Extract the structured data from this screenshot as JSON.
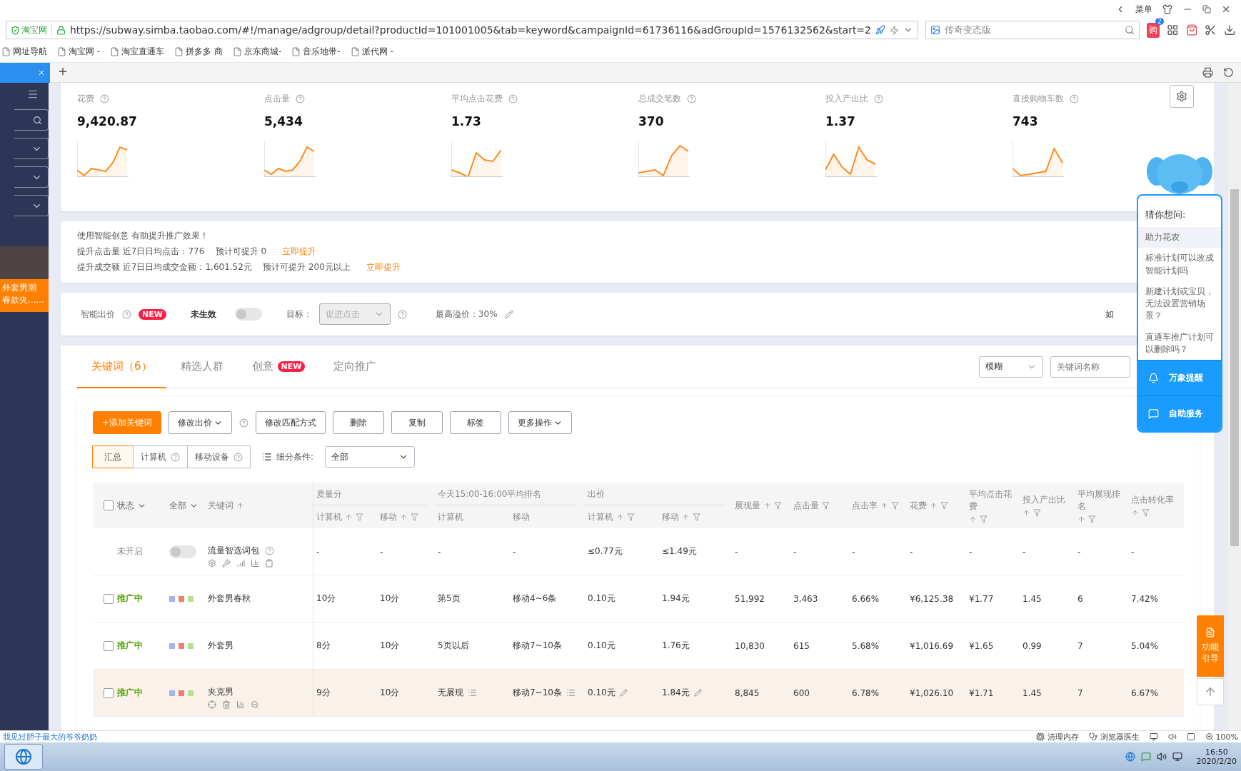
{
  "browser": {
    "menu_label": "菜单",
    "site_badge": "淘宝网",
    "url": "https://subway.simba.taobao.com/#!/manage/adgroup/detail?productId=101001005&tab=keyword&campaignId=61736116&adGroupId=1576132562&start=2",
    "search_text": "传奇变态版",
    "cart_label": "购",
    "cart_count": "2"
  },
  "bookmarks": [
    "网址导航",
    "淘宝网 -",
    "淘宝直通车",
    "拼多多 商",
    "京东商城-",
    "音乐地带-",
    "派代网 -"
  ],
  "sidebar": {
    "promo_lines": [
      "外套男潮",
      "春款夹......"
    ]
  },
  "metrics": [
    {
      "label": "花费",
      "value": "9,420.87"
    },
    {
      "label": "点击量",
      "value": "5,434"
    },
    {
      "label": "平均点击花费",
      "value": "1.73"
    },
    {
      "label": "总成交笔数",
      "value": "370"
    },
    {
      "label": "投入产出比",
      "value": "1.37"
    },
    {
      "label": "直接购物车数",
      "value": "743"
    }
  ],
  "notice": {
    "title": "使用智能创意  有助提升推广效果！",
    "lines": [
      {
        "text": "提升点击量 近7日日均点击：776    预计可提升 0",
        "link": "立即提升"
      },
      {
        "text": "提升成交额 近7日日均成交金额：1,601.52元    预计可提升 200元以上",
        "link": "立即提升"
      }
    ]
  },
  "smart_bid": {
    "label": "智能出价",
    "badge": "NEW",
    "status": "未生效",
    "on": false,
    "target_label": "目标：",
    "target_value": "促进点击",
    "premium": "最高溢价：30%",
    "cut_text": "如"
  },
  "keyword_tabs": [
    {
      "label": "关键词（6）",
      "selected": true
    },
    {
      "label": "精选人群",
      "selected": false
    },
    {
      "label": "创意",
      "selected": false,
      "badge": "NEW"
    },
    {
      "label": "定向推广",
      "selected": false
    }
  ],
  "match_select": "模糊",
  "search_placeholder": "关键词名称",
  "toolbar": [
    {
      "label": "+添加关键词",
      "kind": "primary",
      "help": false
    },
    {
      "label": "修改出价",
      "kind": "dropdown",
      "help": true
    },
    {
      "label": "修改匹配方式",
      "kind": "plain",
      "help": false
    },
    {
      "label": "删除",
      "kind": "plain",
      "help": false
    },
    {
      "label": "复制",
      "kind": "plain",
      "help": false
    },
    {
      "label": "标签",
      "kind": "plain",
      "help": false
    },
    {
      "label": "更多操作",
      "kind": "dropdown",
      "help": false
    }
  ],
  "segments": [
    {
      "label": "汇总",
      "selected": true,
      "help": false
    },
    {
      "label": "计算机",
      "selected": false,
      "help": true
    },
    {
      "label": "移动设备",
      "selected": false,
      "help": true
    }
  ],
  "filter": {
    "label": "细分条件:",
    "value": "全部"
  },
  "table": {
    "head": {
      "status": "状态",
      "all": "全部",
      "keyword": "关键词",
      "checked": false
    },
    "group_titles": [
      "质量分",
      "今天15:00-16:00平均排名",
      "出价"
    ],
    "columns": [
      {
        "label": "计算机",
        "kind": "lead",
        "sort": true,
        "filter": true
      },
      {
        "label": "移动",
        "kind": "sub",
        "sort": true,
        "filter": true
      },
      {
        "label": "计算机",
        "kind": "lead",
        "sort": false,
        "filter": false
      },
      {
        "label": "移动",
        "kind": "sub",
        "sort": false,
        "filter": false
      },
      {
        "label": "计算机",
        "kind": "lead",
        "sort": true,
        "filter": true
      },
      {
        "label": "移动",
        "kind": "sub",
        "sort": true,
        "filter": true
      },
      {
        "label": "展现量",
        "kind": "single",
        "sort": true,
        "filter": true
      },
      {
        "label": "点击量",
        "kind": "single",
        "sort": false,
        "filter": true
      },
      {
        "label": "点击率",
        "kind": "single",
        "sort": true,
        "filter": true
      },
      {
        "label": "花费",
        "kind": "single",
        "sort": true,
        "filter": true
      },
      {
        "label": "平均点击花费",
        "kind": "single",
        "sort": true,
        "filter": true
      },
      {
        "label": "投入产出比",
        "kind": "single",
        "sort": true,
        "filter": true
      },
      {
        "label": "平均展现排名",
        "kind": "single",
        "sort": true,
        "filter": true
      },
      {
        "label": "点击转化率",
        "kind": "single",
        "sort": true,
        "filter": true
      }
    ],
    "rows": [
      {
        "kind": "package",
        "status": "未开启",
        "on": false,
        "name": "流量智选词包",
        "highlighted": false,
        "cells": [
          "-",
          "-",
          "-",
          "-",
          "≤0.77元",
          "≤1.49元",
          "-",
          "-",
          "-",
          "-",
          "-",
          "-",
          "-",
          "-"
        ]
      },
      {
        "kind": "keyword",
        "checked": false,
        "status": "推广中",
        "tags": [
          {
            "color": "#a4b4f0"
          },
          {
            "color": "#f27c70"
          },
          {
            "color": "#b6e08e"
          }
        ],
        "name": "外套男春秋",
        "highlighted": false,
        "cells": [
          "10分",
          "10分",
          "第5页",
          "移动4~6条",
          "0.10元",
          "1.94元",
          "51,992",
          "3,463",
          "6.66%",
          "¥6,125.38",
          "¥1.77",
          "1.45",
          "6",
          "7.42%"
        ]
      },
      {
        "kind": "keyword",
        "checked": false,
        "status": "推广中",
        "tags": [
          {
            "color": "#a4b4f0"
          },
          {
            "color": "#f27c70"
          },
          {
            "color": "#b6e08e"
          }
        ],
        "name": "外套男",
        "highlighted": false,
        "cells": [
          "8分",
          "10分",
          "5页以后",
          "移动7~10条",
          "0.10元",
          "1.76元",
          "10,830",
          "615",
          "5.68%",
          "¥1,016.69",
          "¥1.65",
          "0.99",
          "7",
          "5.04%"
        ]
      },
      {
        "kind": "keyword",
        "checked": false,
        "status": "推广中",
        "tags": [
          {
            "color": "#a4b4f0"
          },
          {
            "color": "#f27c70"
          },
          {
            "color": "#b6e08e"
          }
        ],
        "name": "夹克男",
        "highlighted": true,
        "cells": [
          "9分",
          "10分",
          "无展现",
          "移动7~10条",
          "0.10元",
          "1.84元",
          "8,845",
          "600",
          "6.78%",
          "¥1,026.10",
          "¥1.71",
          "1.45",
          "7",
          "6.67%"
        ]
      }
    ]
  },
  "assistant": {
    "title": "猜你想问:",
    "questions": [
      {
        "text": "助力花农",
        "selected": true
      },
      {
        "text": "标准计划可以改成智能计划吗",
        "selected": false
      },
      {
        "text": "新建计划或宝贝，无法设置营销场景？",
        "selected": false
      },
      {
        "text": "直通车推广计划可以删除吗？",
        "selected": false
      }
    ],
    "actions": [
      {
        "label": "万象提醒",
        "kind": "bell"
      },
      {
        "label": "自助服务",
        "kind": "chat"
      }
    ]
  },
  "guide": {
    "label": "功能引导"
  },
  "status_bar": {
    "link": "我见过胆子最大的爷爷奶奶",
    "tools": [
      "清理内存",
      "浏览器医生"
    ],
    "zoom": "100%"
  },
  "taskbar": {
    "time": "16:50",
    "date": "2020/2/20"
  }
}
